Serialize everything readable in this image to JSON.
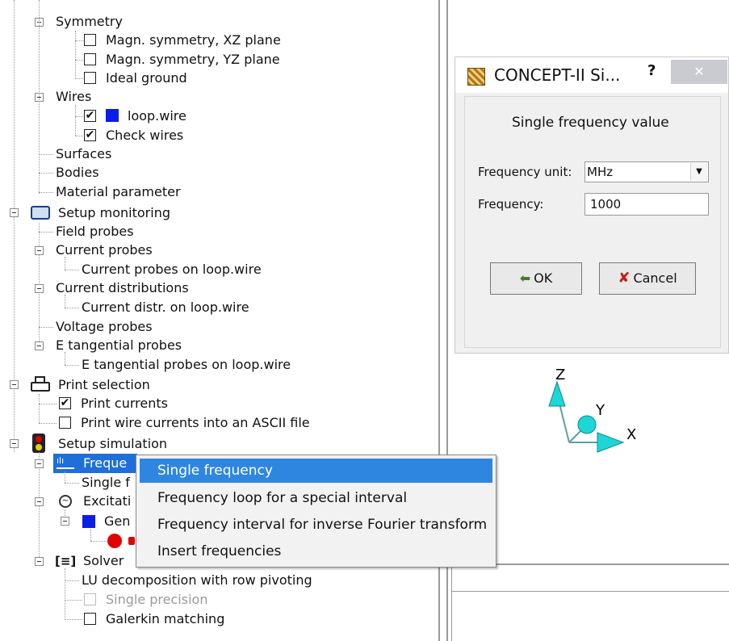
{
  "tree": {
    "symmetry": "Symmetry",
    "magn_xz": "Magn. symmetry, XZ plane",
    "magn_yz": "Magn. symmetry, YZ plane",
    "ideal_ground": "Ideal ground",
    "wires": "Wires",
    "loop_wire": "loop.wire",
    "check_wires": "Check wires",
    "surfaces": "Surfaces",
    "bodies": "Bodies",
    "material_parameter": "Material parameter",
    "setup_monitoring": "Setup monitoring",
    "field_probes": "Field probes",
    "current_probes": "Current probes",
    "current_probes_on_loop": "Current probes on loop.wire",
    "current_distributions": "Current distributions",
    "current_distr_on_loop": "Current distr. on loop.wire",
    "voltage_probes": "Voltage probes",
    "e_tangential_probes": "E tangential probes",
    "e_tangential_on_loop": "E tangential probes on loop.wire",
    "print_selection": "Print selection",
    "print_currents": "Print currents",
    "print_wire_currents_ascii": "Print wire currents into an ASCII file",
    "setup_simulation": "Setup simulation",
    "frequency_partial": "Freque",
    "single_f_partial": "Single f",
    "excitation_partial": "Excitati",
    "gen_partial": "Gen",
    "solver": "Solver",
    "lu_decomposition": "LU decomposition with row pivoting",
    "single_precision": "Single precision",
    "galerkin_matching": "Galerkin matching",
    "checked_mark": "✔"
  },
  "context_menu": {
    "items": [
      "Single frequency",
      "Frequency loop for a special interval",
      "Frequency interval for inverse Fourier transform",
      "Insert frequencies"
    ]
  },
  "dialog": {
    "title": "CONCEPT-II Si...",
    "help": "?",
    "close": "✕",
    "heading": "Single frequency value",
    "unit_label": "Frequency unit:",
    "unit_value": "MHz",
    "freq_label": "Frequency:",
    "freq_value": "1000",
    "ok": "OK",
    "cancel": "Cancel"
  },
  "axes": {
    "z": "Z",
    "y": "Y",
    "x": "X"
  },
  "colors": {
    "wire_blue": "#0b1ee8",
    "menu_highlight": "#2f86e0",
    "axis_cyan": "#1fd6d6",
    "excitation_red": "#e00000"
  }
}
